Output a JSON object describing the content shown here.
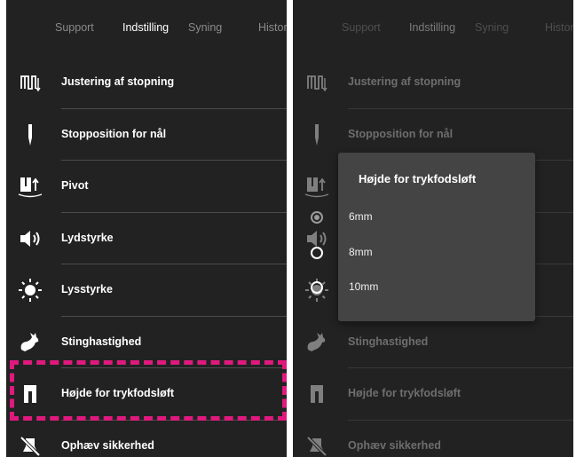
{
  "tabs": [
    "Support",
    "Indstilling",
    "Syning",
    "Historik"
  ],
  "active_tab": "Indstilling",
  "settings": [
    {
      "label": "Justering af stopning",
      "icon": "stitch-adjust-icon"
    },
    {
      "label": "Stopposition for nål",
      "icon": "needle-icon"
    },
    {
      "label": "Pivot",
      "icon": "pivot-icon"
    },
    {
      "label": "Lydstyrke",
      "icon": "speaker-icon"
    },
    {
      "label": "Lysstyrke",
      "icon": "brightness-icon"
    },
    {
      "label": "Stinghastighed",
      "icon": "rabbit-icon"
    },
    {
      "label": "Højde for trykfodsløft",
      "icon": "presser-foot-icon"
    },
    {
      "label": "Ophæv sikkerhed",
      "icon": "safety-off-icon"
    }
  ],
  "highlighted_item": "Højde for trykfodsløft",
  "colors": {
    "background": "#222222",
    "highlight": "#e0197d",
    "dialog": "#444444"
  },
  "dialog": {
    "title": "Højde for trykfodsløft",
    "options": [
      "6mm",
      "8mm",
      "10mm"
    ],
    "selected": "6mm"
  }
}
